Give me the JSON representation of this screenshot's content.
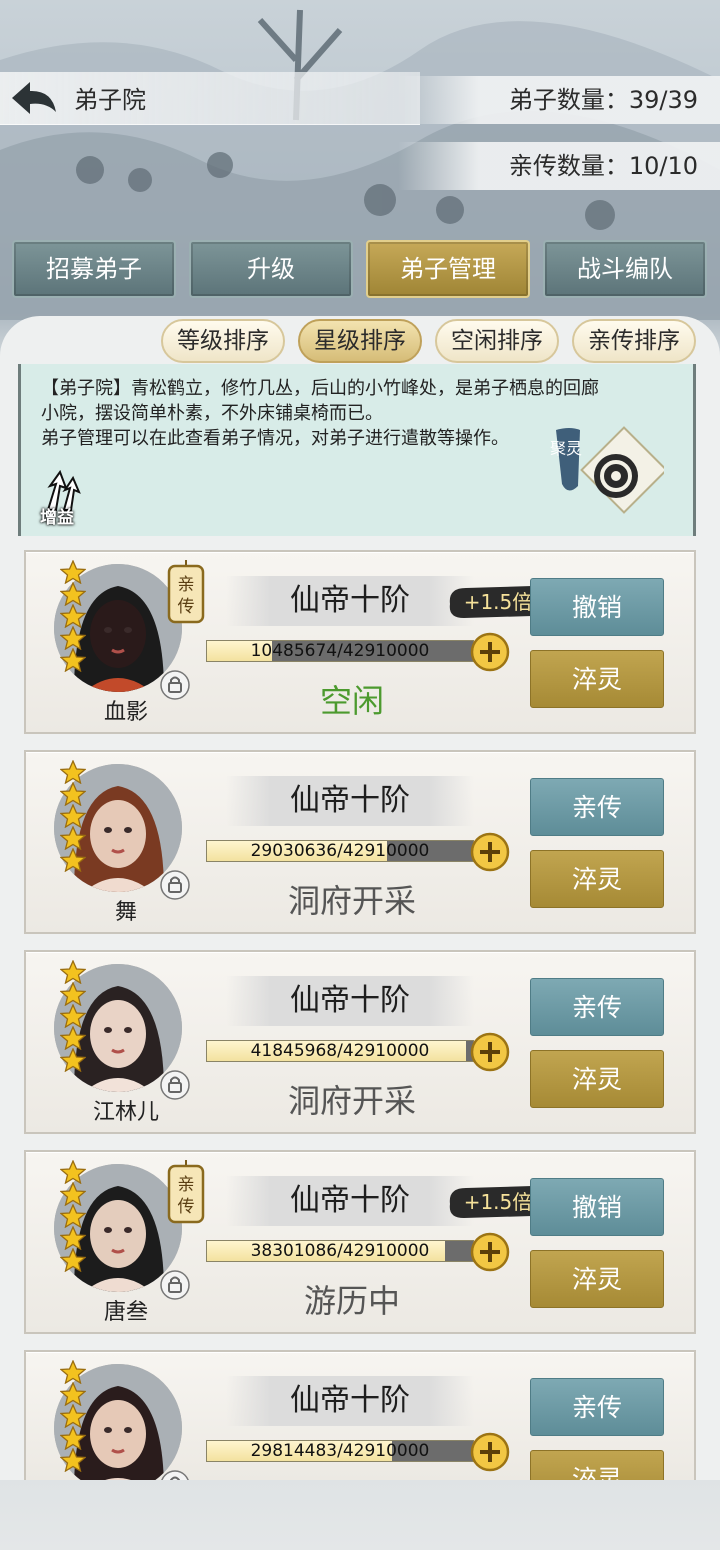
{
  "header": {
    "title": "弟子院",
    "disciple_count_label": "弟子数量：39/39",
    "direct_count_label": "亲传数量：10/10"
  },
  "tabs": [
    {
      "label": "招募弟子",
      "active": false
    },
    {
      "label": "升级",
      "active": false
    },
    {
      "label": "弟子管理",
      "active": true
    },
    {
      "label": "战斗编队",
      "active": false
    }
  ],
  "sort_buttons": [
    {
      "label": "等级排序",
      "active": false
    },
    {
      "label": "星级排序",
      "active": true
    },
    {
      "label": "空闲排序",
      "active": false
    },
    {
      "label": "亲传排序",
      "active": false
    }
  ],
  "description": {
    "line1": "【弟子院】青松鹤立，修竹几丛，后山的小竹峰处，是弟子栖息的回廊",
    "line2": "小院，摆设简单朴素，不外床铺桌椅而已。",
    "line3": "弟子管理可以在此查看弟子情况，对弟子进行遣散等操作。",
    "buff_label": "增益",
    "juling_label": "聚灵"
  },
  "disciples": [
    {
      "name": "血影",
      "rank": "仙帝十阶",
      "exp": "10485674/42910000",
      "progress": 0.244,
      "status": "空闲",
      "bonus": "+1.5倍",
      "direct": true,
      "stars": 5,
      "btn_top": "撤销",
      "btn_bottom": "淬灵"
    },
    {
      "name": "舞",
      "rank": "仙帝十阶",
      "exp": "29030636/42910000",
      "progress": 0.677,
      "status": "洞府开采",
      "bonus": "",
      "direct": false,
      "stars": 5,
      "btn_top": "亲传",
      "btn_bottom": "淬灵"
    },
    {
      "name": "江林儿",
      "rank": "仙帝十阶",
      "exp": "41845968/42910000",
      "progress": 0.975,
      "status": "洞府开采",
      "bonus": "",
      "direct": false,
      "stars": 5,
      "btn_top": "亲传",
      "btn_bottom": "淬灵"
    },
    {
      "name": "唐叁",
      "rank": "仙帝十阶",
      "exp": "38301086/42910000",
      "progress": 0.893,
      "status": "游历中",
      "bonus": "+1.5倍",
      "direct": true,
      "stars": 5,
      "btn_top": "撤销",
      "btn_bottom": "淬灵"
    },
    {
      "name": "",
      "rank": "仙帝十阶",
      "exp": "29814483/42910000",
      "progress": 0.695,
      "status": "",
      "bonus": "",
      "direct": false,
      "stars": 5,
      "btn_top": "亲传",
      "btn_bottom": "淬灵"
    }
  ],
  "direct_badge": "亲传",
  "colors": {
    "gold": "#b3983f",
    "teal": "#6a97a1",
    "idle_green": "#4c9a2e"
  }
}
